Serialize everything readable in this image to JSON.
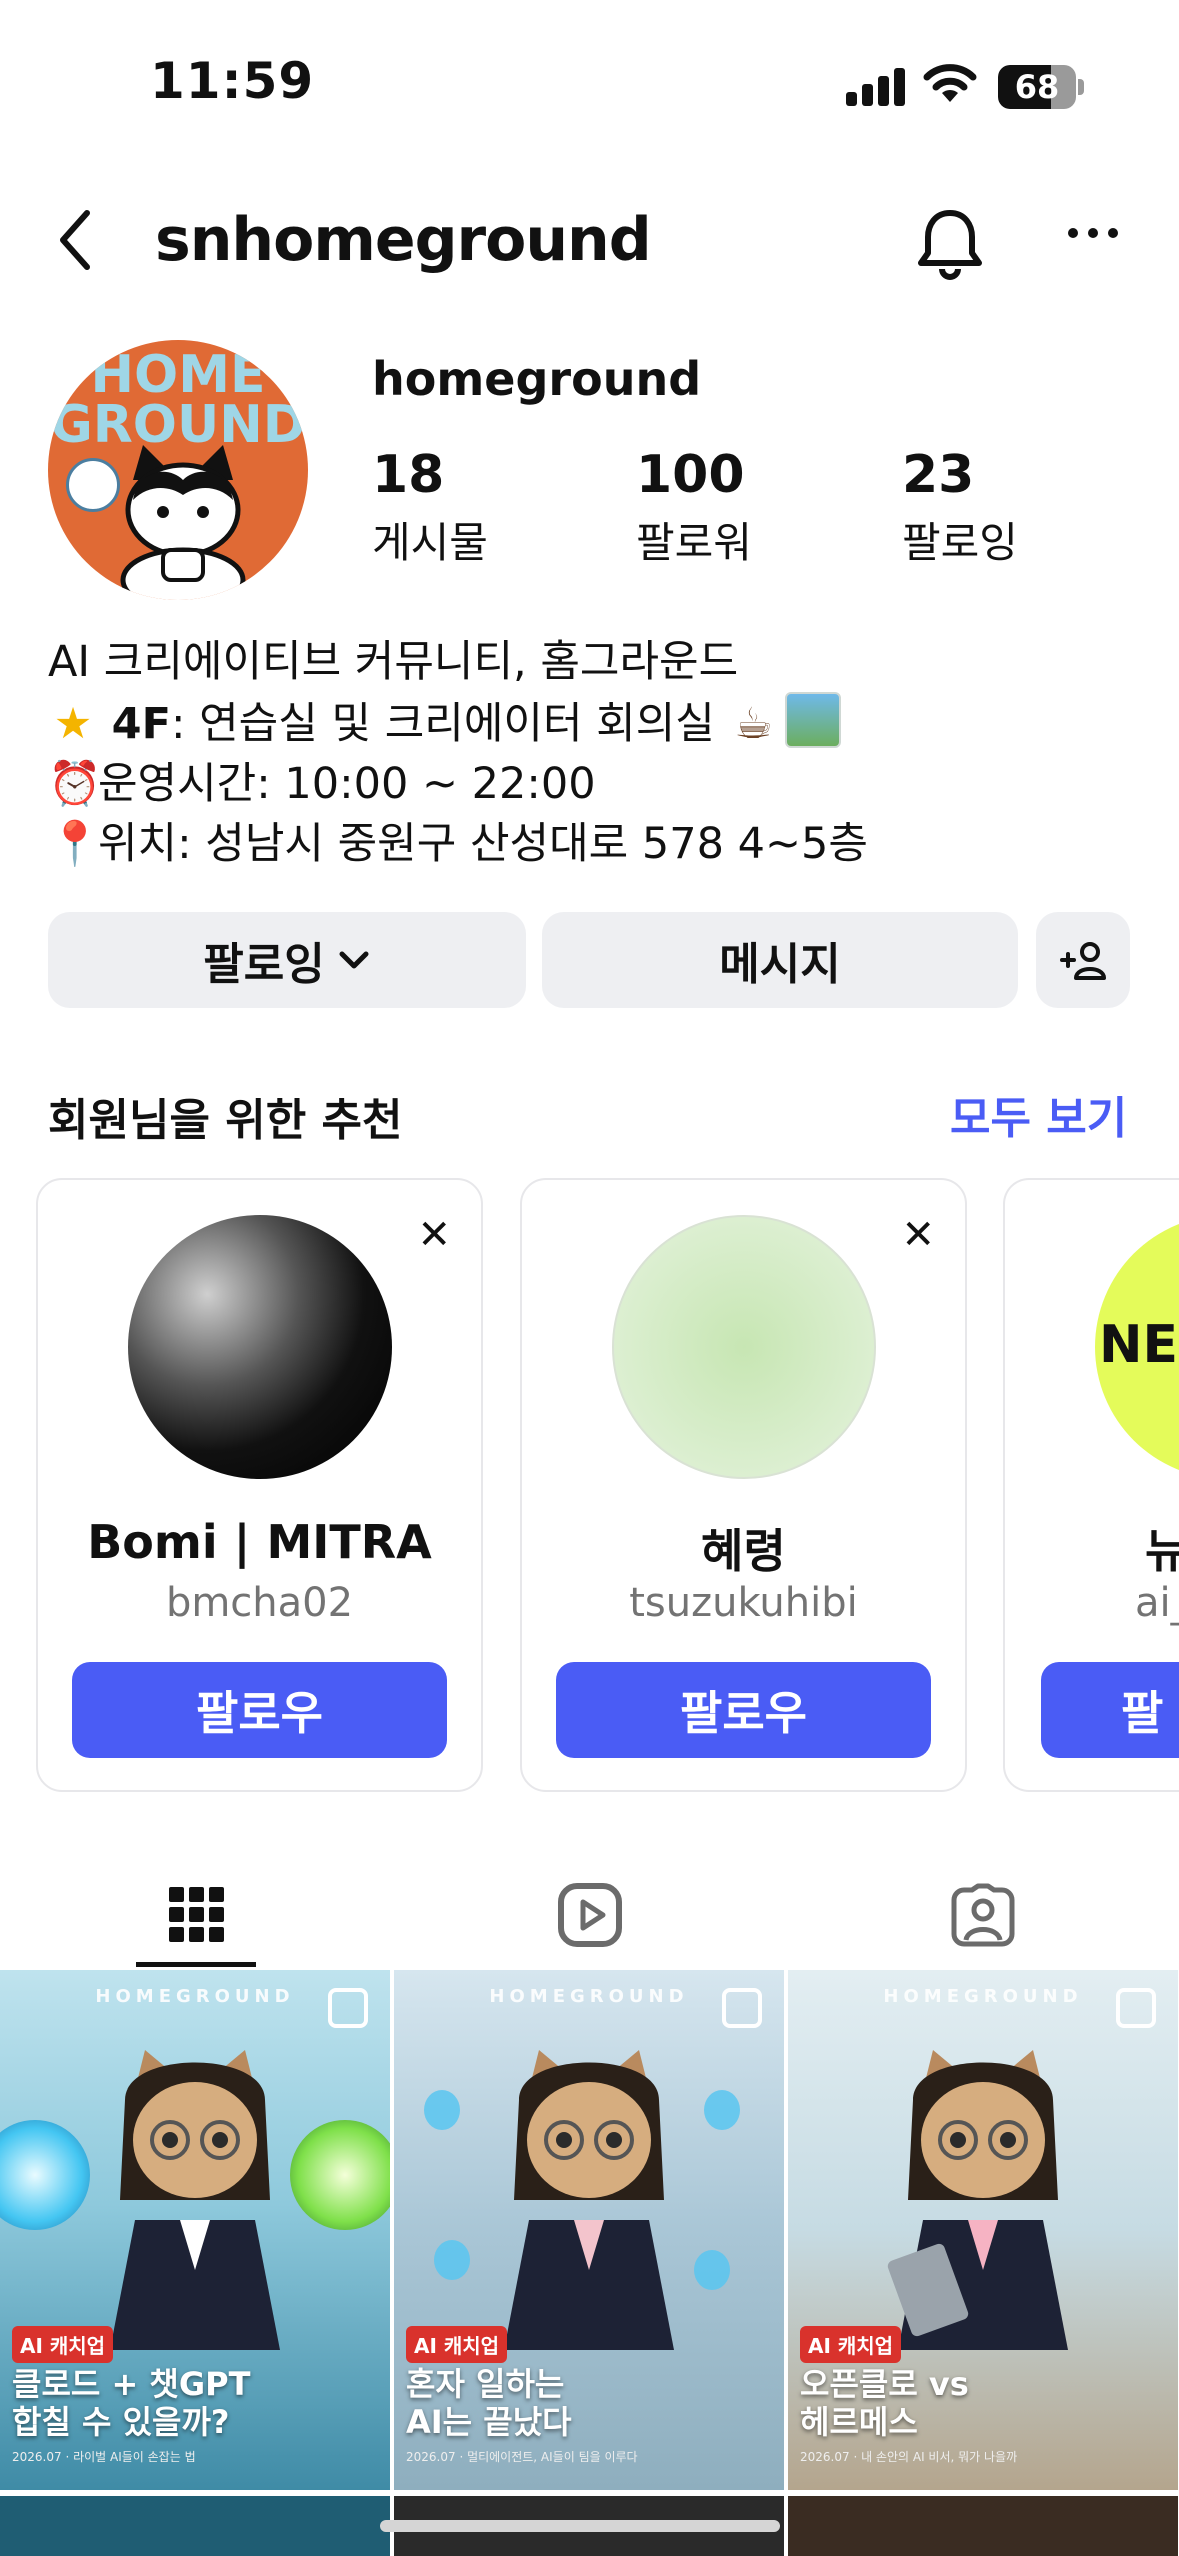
{
  "status_bar": {
    "time": "11:59",
    "battery": "68",
    "battery_level": 0.68
  },
  "header": {
    "username": "snhomeground"
  },
  "profile": {
    "avatar_text": "HOME GROUND",
    "display_name": "homeground",
    "stats": [
      {
        "value": "18",
        "label": "게시물"
      },
      {
        "value": "100",
        "label": "팔로워"
      },
      {
        "value": "23",
        "label": "팔로잉"
      }
    ],
    "bio": {
      "line1": "AI 크리에이티브 커뮤니티, 홈그라운드",
      "line2_bold": "4F",
      "line2_rest": ": 연습실 및 크리에이터 회의실",
      "line3": "운영시간: 10:00 ~ 22:00",
      "line4": "위치: 성남시 중원구 산성대로 578 4~5층"
    },
    "bio_icons": [
      "star-emoji",
      "coffee-emoji",
      "landscape-image",
      "alarm-clock-emoji",
      "pin-emoji"
    ]
  },
  "actions": {
    "following": "팔로잉",
    "message": "메시지"
  },
  "suggestions": {
    "title": "회원님을 위한 추천",
    "see_all": "모두 보기",
    "cards": [
      {
        "name": "Bomi | MITRA",
        "username": "bmcha02",
        "follow": "팔로우"
      },
      {
        "name": "혜령",
        "username": "tsuzukuhibi",
        "follow": "팔로우"
      },
      {
        "name": "뉴",
        "username": "ai_",
        "follow": "팔",
        "avatar_text": "NE"
      }
    ]
  },
  "tabs": [
    "grid-icon",
    "reels-icon",
    "tagged-icon"
  ],
  "posts": [
    {
      "brand": "HOMEGROUND",
      "tag": "AI 캐치업",
      "line1": "클로드 + 챗GPT",
      "line2": "합칠 수 있을까?",
      "sub": "2026.07 · 라이벌 AI들이 손잡는 법"
    },
    {
      "brand": "HOMEGROUND",
      "tag": "AI 캐치업",
      "line1": "혼자 일하는",
      "line2": "AI는 끝났다",
      "sub": "2026.07 · 멀티에이전트, AI들이 팀을 이루다"
    },
    {
      "brand": "HOMEGROUND",
      "tag": "AI 캐치업",
      "line1": "오픈클로 vs",
      "line2": "헤르메스",
      "sub": "2026.07 · 내 손안의 AI 비서, 뭐가 나을까"
    }
  ],
  "colors": {
    "accent": "#4a5cf5",
    "tag_red": "#d9322c",
    "button_grey": "#eeeff2"
  }
}
